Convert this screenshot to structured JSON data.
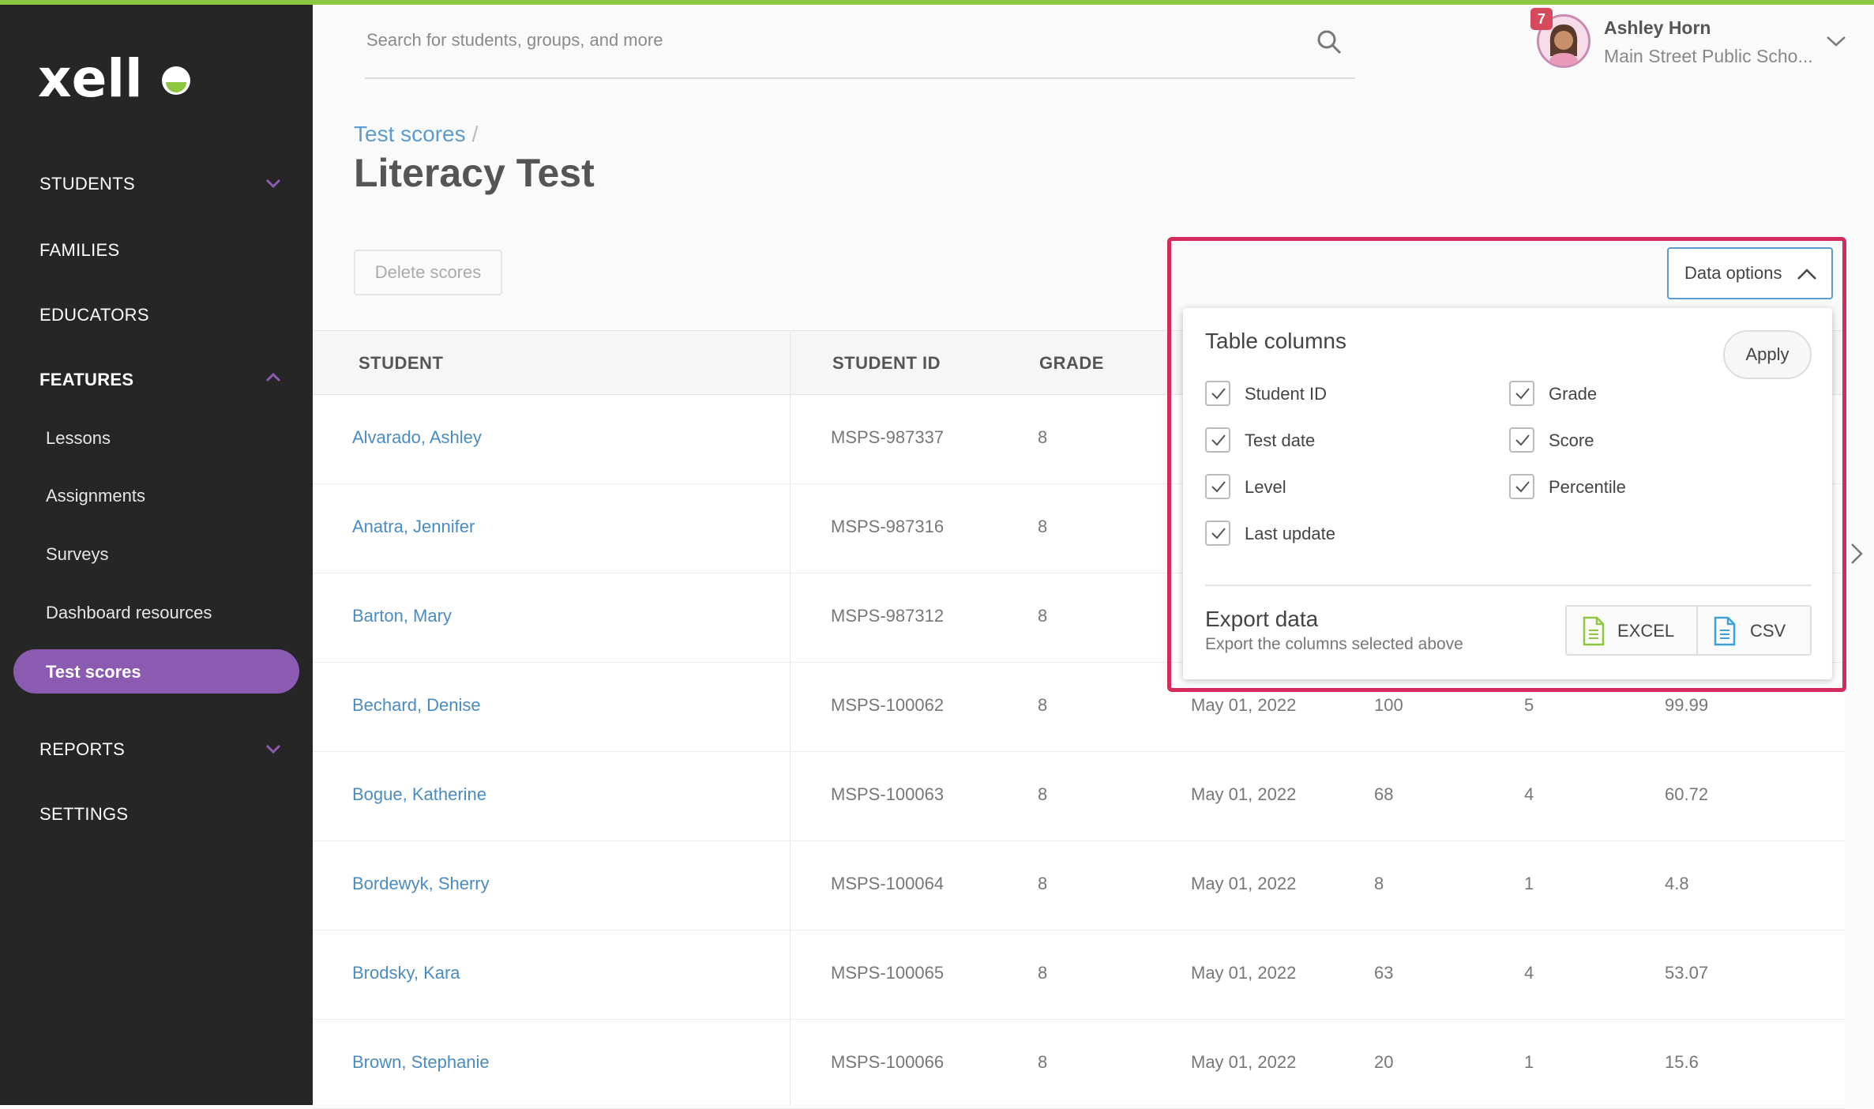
{
  "brand": {
    "name": "xello",
    "accent": "#8dc63f",
    "nav_active": "#8a5bb0",
    "highlight": "#d42b5a"
  },
  "sidebar": {
    "items": [
      {
        "label": "STUDENTS",
        "chevron": "down"
      },
      {
        "label": "FAMILIES"
      },
      {
        "label": "EDUCATORS"
      },
      {
        "label": "FEATURES",
        "chevron": "up"
      },
      {
        "label": "REPORTS",
        "chevron": "down"
      },
      {
        "label": "SETTINGS"
      }
    ],
    "features_sub": [
      "Lessons",
      "Assignments",
      "Surveys",
      "Dashboard resources",
      "Test scores"
    ]
  },
  "search": {
    "placeholder": "Search for students, groups, and more"
  },
  "user": {
    "name": "Ashley Horn",
    "school": "Main Street Public Scho...",
    "notifications": "7"
  },
  "page": {
    "breadcrumb": "Test scores",
    "separator": "/",
    "title": "Literacy Test",
    "delete_label": "Delete scores"
  },
  "table": {
    "headers": [
      "STUDENT",
      "STUDENT ID",
      "GRADE"
    ],
    "rows": [
      {
        "name": "Alvarado, Ashley",
        "id": "MSPS-987337",
        "grade": "8",
        "date": "",
        "score": "",
        "level": "",
        "percentile": ""
      },
      {
        "name": "Anatra, Jennifer",
        "id": "MSPS-987316",
        "grade": "8",
        "date": "",
        "score": "",
        "level": "",
        "percentile": ""
      },
      {
        "name": "Barton, Mary",
        "id": "MSPS-987312",
        "grade": "8",
        "date": "",
        "score": "",
        "level": "",
        "percentile": ""
      },
      {
        "name": "Bechard, Denise",
        "id": "MSPS-100062",
        "grade": "8",
        "date": "May 01, 2022",
        "score": "100",
        "level": "5",
        "percentile": "99.99"
      },
      {
        "name": "Bogue, Katherine",
        "id": "MSPS-100063",
        "grade": "8",
        "date": "May 01, 2022",
        "score": "68",
        "level": "4",
        "percentile": "60.72"
      },
      {
        "name": "Bordewyk, Sherry",
        "id": "MSPS-100064",
        "grade": "8",
        "date": "May 01, 2022",
        "score": "8",
        "level": "1",
        "percentile": "4.8"
      },
      {
        "name": "Brodsky, Kara",
        "id": "MSPS-100065",
        "grade": "8",
        "date": "May 01, 2022",
        "score": "63",
        "level": "4",
        "percentile": "53.07"
      },
      {
        "name": "Brown, Stephanie",
        "id": "MSPS-100066",
        "grade": "8",
        "date": "May 01, 2022",
        "score": "20",
        "level": "1",
        "percentile": "15.6"
      }
    ]
  },
  "data_options": {
    "button_label": "Data options",
    "table_columns_title": "Table columns",
    "apply_label": "Apply",
    "columns": [
      {
        "label": "Student ID",
        "checked": true
      },
      {
        "label": "Grade",
        "checked": true
      },
      {
        "label": "Test date",
        "checked": true
      },
      {
        "label": "Score",
        "checked": true
      },
      {
        "label": "Level",
        "checked": true
      },
      {
        "label": "Percentile",
        "checked": true
      },
      {
        "label": "Last update",
        "checked": true
      }
    ],
    "export_title": "Export data",
    "export_subtitle": "Export the columns selected above",
    "excel_label": "EXCEL",
    "csv_label": "CSV"
  }
}
